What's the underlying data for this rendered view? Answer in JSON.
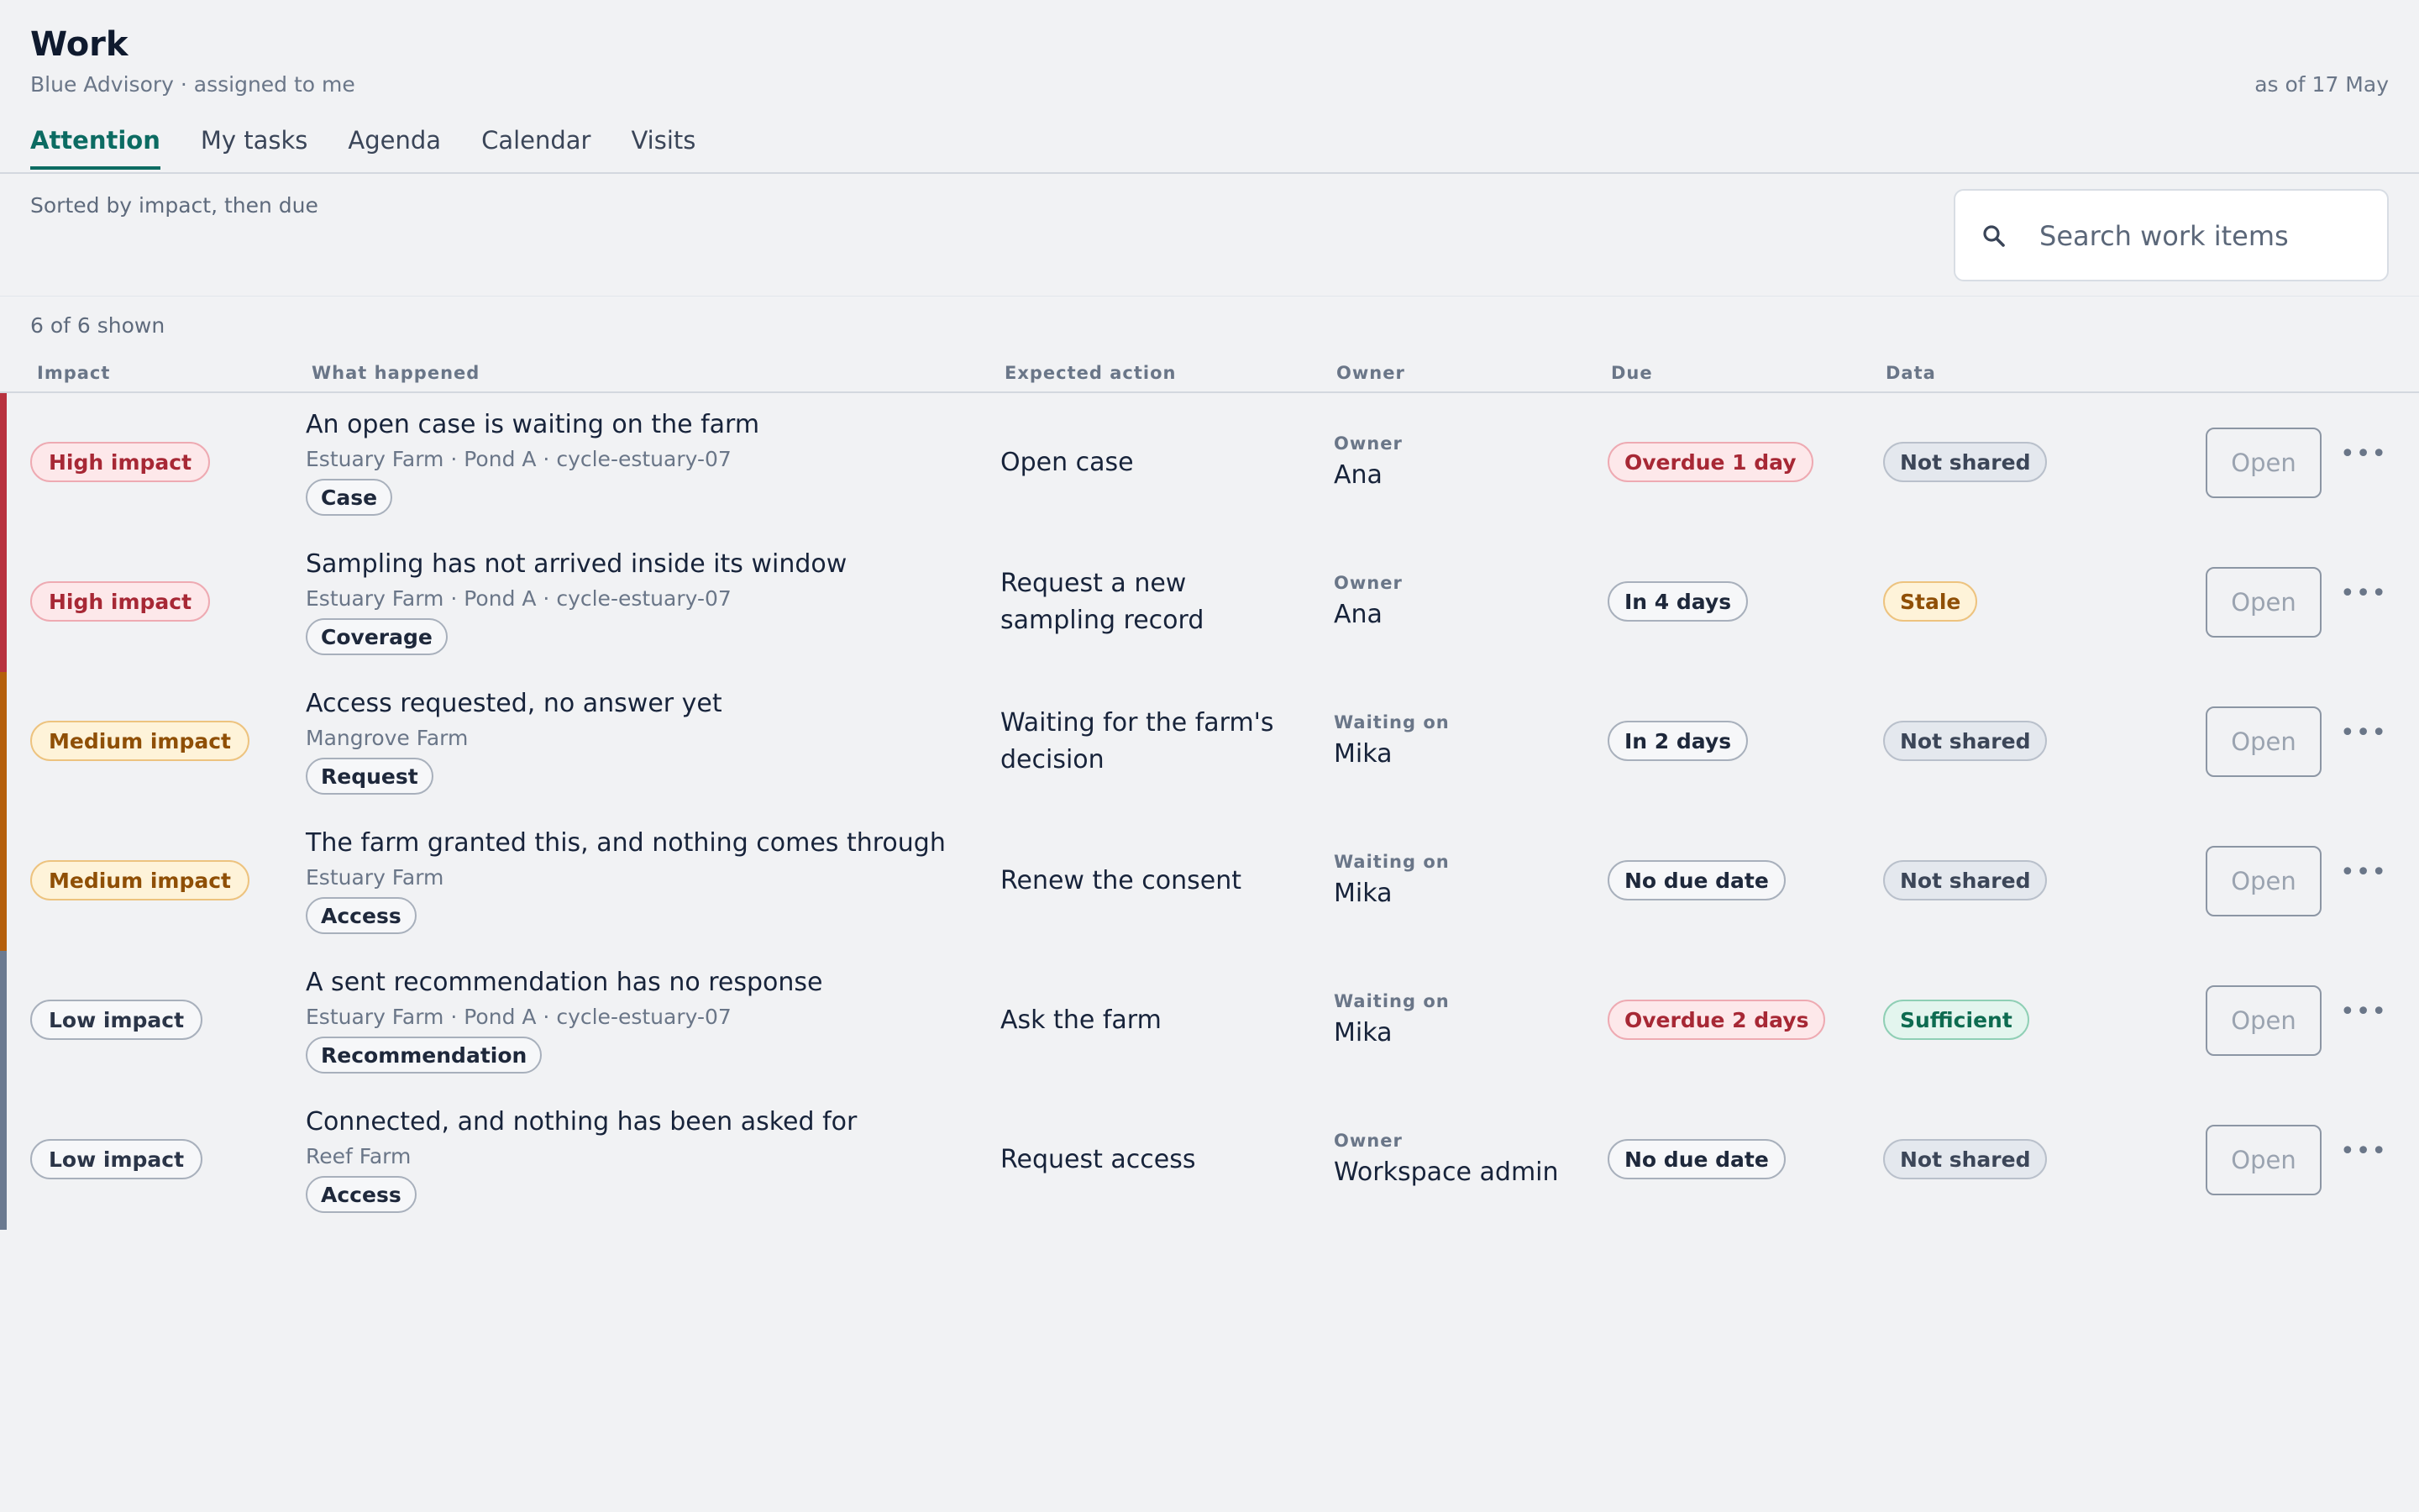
{
  "header": {
    "title": "Work",
    "subtitle": "Blue Advisory · assigned to me",
    "as_of": "as of 17 May"
  },
  "tabs": [
    {
      "label": "Attention",
      "active": true
    },
    {
      "label": "My tasks",
      "active": false
    },
    {
      "label": "Agenda",
      "active": false
    },
    {
      "label": "Calendar",
      "active": false
    },
    {
      "label": "Visits",
      "active": false
    }
  ],
  "sort_note": "Sorted by impact, then due",
  "search": {
    "placeholder": "Search work items",
    "value": "",
    "icon": "search-icon"
  },
  "count": "6 of 6 shown",
  "columns": {
    "impact": "Impact",
    "what": "What happened",
    "action": "Expected action",
    "owner": "Owner",
    "due": "Due",
    "data": "Data"
  },
  "colors": {
    "accent": "#0c6b62",
    "impact_high": "#b8323f",
    "impact_medium": "#b55f0b",
    "impact_low": "#6b7a90"
  },
  "rows": [
    {
      "impact": "High impact",
      "title": "An open case is waiting on the farm",
      "sub": "Estuary Farm · Pond A · cycle-estuary-07",
      "tag": "Case",
      "action": "Open case",
      "owner_label": "Owner",
      "owner": "Ana",
      "due": "Overdue 1 day",
      "data": "Not shared",
      "open": "Open"
    },
    {
      "impact": "High impact",
      "title": "Sampling has not arrived inside its window",
      "sub": "Estuary Farm · Pond A · cycle-estuary-07",
      "tag": "Coverage",
      "action": "Request a new sampling record",
      "owner_label": "Owner",
      "owner": "Ana",
      "due": "In 4 days",
      "data": "Stale",
      "open": "Open"
    },
    {
      "impact": "Medium impact",
      "title": "Access requested, no answer yet",
      "sub": "Mangrove Farm",
      "tag": "Request",
      "action": "Waiting for the farm's decision",
      "owner_label": "Waiting on",
      "owner": "Mika",
      "due": "In 2 days",
      "data": "Not shared",
      "open": "Open"
    },
    {
      "impact": "Medium impact",
      "title": "The farm granted this, and nothing comes through",
      "sub": "Estuary Farm",
      "tag": "Access",
      "action": "Renew the consent",
      "owner_label": "Waiting on",
      "owner": "Mika",
      "due": "No due date",
      "data": "Not shared",
      "open": "Open"
    },
    {
      "impact": "Low impact",
      "title": "A sent recommendation has no response",
      "sub": "Estuary Farm · Pond A · cycle-estuary-07",
      "tag": "Recommendation",
      "action": "Ask the farm",
      "owner_label": "Waiting on",
      "owner": "Mika",
      "due": "Overdue 2 days",
      "data": "Sufficient",
      "open": "Open"
    },
    {
      "impact": "Low impact",
      "title": "Connected, and nothing has been asked for",
      "sub": "Reef Farm",
      "tag": "Access",
      "action": "Request access",
      "owner_label": "Owner",
      "owner": "Workspace admin",
      "due": "No due date",
      "data": "Not shared",
      "open": "Open"
    }
  ]
}
